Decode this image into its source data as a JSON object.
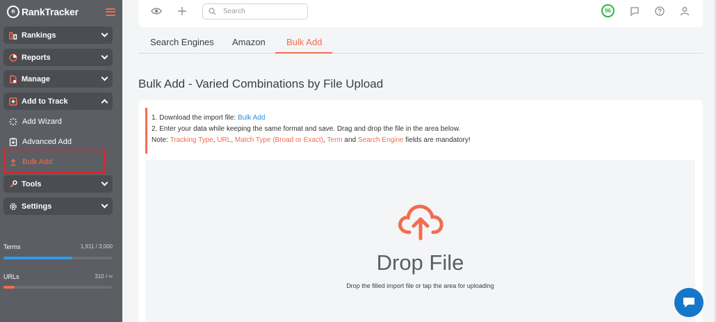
{
  "sidebar": {
    "brand": "RankTracker",
    "brand_mark": "R",
    "groups": [
      {
        "label": "Rankings",
        "icon": "rankings-icon"
      },
      {
        "label": "Reports",
        "icon": "reports-icon"
      },
      {
        "label": "Manage",
        "icon": "manage-icon"
      },
      {
        "label": "Add to Track",
        "icon": "add-to-track-icon"
      },
      {
        "label": "Tools",
        "icon": "tools-icon"
      },
      {
        "label": "Settings",
        "icon": "settings-icon"
      }
    ],
    "sub_items": [
      {
        "label": "Add Wizard",
        "icon": "wizard-icon"
      },
      {
        "label": "Advanced Add",
        "icon": "advanced-add-icon"
      },
      {
        "label": "Bulk Add",
        "icon": "upload-icon",
        "active": true
      }
    ],
    "stats": {
      "terms": {
        "label": "Terms",
        "value": "1,911 / 3,000",
        "fraction": 0.637,
        "color": "#2e9be6"
      },
      "urls": {
        "label": "URLs",
        "value": "310 / ∞",
        "fraction": 0.1,
        "color": "#f26d4f"
      }
    }
  },
  "topbar": {
    "search_placeholder": "Search",
    "score_badge": "96"
  },
  "tabs": [
    {
      "label": "Search Engines"
    },
    {
      "label": "Amazon"
    },
    {
      "label": "Bulk Add",
      "active": true
    }
  ],
  "page_title": "Bulk Add - Varied Combinations by File Upload",
  "instructions": {
    "line1_prefix": "1. Download the import file: ",
    "line1_link": "Bulk Add",
    "line2": "2. Enter your data while keeping the same format and save. Drag and drop the file in the area below.",
    "note_prefix": "Note: ",
    "req1": "Tracking Type",
    "sep1": ", ",
    "req2": "URL",
    "sep2": ", ",
    "req3": "Match Type (Broad or Exact)",
    "sep3": ", ",
    "req4": "Term",
    "sep4": " and ",
    "req5": "Search Engine",
    "suffix": " fields are mandatory!"
  },
  "dropzone": {
    "title": "Drop File",
    "subtitle": "Drop the filled import file or tap the area for uploading"
  },
  "colors": {
    "accent": "#f26d4f",
    "sidebar_bg": "#5b5e63",
    "link": "#2d8fd8",
    "chat": "#1677c9",
    "score": "#2fb24a"
  }
}
